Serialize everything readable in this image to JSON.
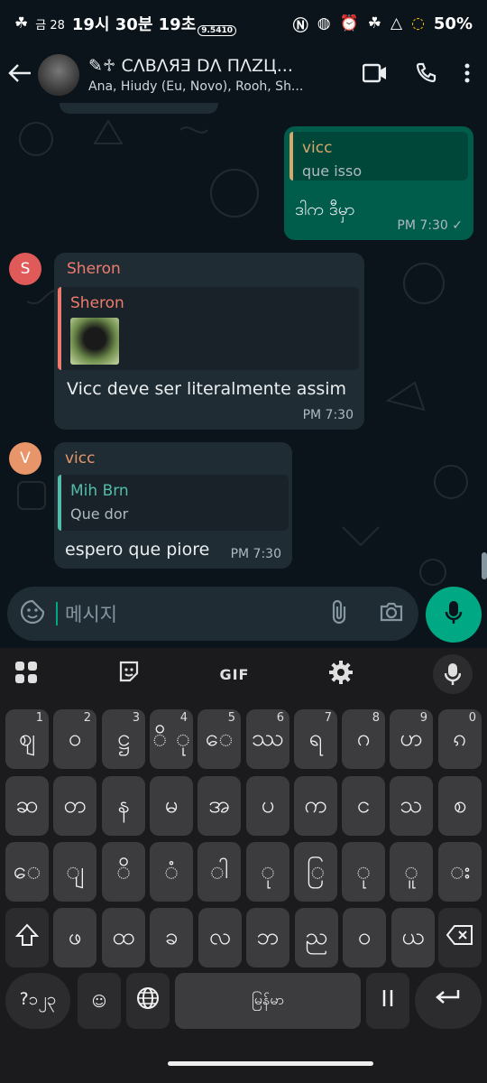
{
  "status": {
    "time": "19시 30분 19초",
    "date_prefix": "금 28",
    "badge": "9.5410",
    "battery": "50%"
  },
  "header": {
    "title": "✎♱ CΛBΛЯƎ DΛ ПΛZЦ...",
    "subtitle": "Ana, Hiudy (Eu, Novo), Rooh, Sh..."
  },
  "messages": {
    "m1": {
      "quote_name": "vicc",
      "quote_text": "que isso",
      "text": "ဒါက ဒီမှာ",
      "time": "PM 7:30",
      "check": "✓"
    },
    "m2": {
      "avatar_letter": "S",
      "sender": "Sheron",
      "quote_name": "Sheron",
      "text": "Vicc deve ser literalmente assim",
      "time": "PM 7:30"
    },
    "m3": {
      "avatar_letter": "V",
      "sender": "vicc",
      "quote_name": "Mih Brn",
      "quote_text": "Que dor",
      "text": "espero que piore",
      "time": "PM 7:30"
    }
  },
  "input": {
    "placeholder": "메시지"
  },
  "keyboard": {
    "gif_label": "GIF",
    "row1": [
      {
        "char": "ဈ",
        "num": "1"
      },
      {
        "char": "ဝ",
        "num": "2"
      },
      {
        "char": "ဋ္ဌ",
        "num": "3"
      },
      {
        "char": "ိ ု",
        "num": "4"
      },
      {
        "char": "ေ",
        "num": "5"
      },
      {
        "char": "ဿ",
        "num": "6"
      },
      {
        "char": "ရ",
        "num": "7"
      },
      {
        "char": "ဂ",
        "num": "8"
      },
      {
        "char": "ဟ",
        "num": "9"
      },
      {
        "char": "ၵ",
        "num": "0"
      }
    ],
    "row2": [
      "ဆ",
      "တ",
      "န",
      "မ",
      "အ",
      "ပ",
      "က",
      "င",
      "သ",
      "စ"
    ],
    "row3": [
      "ေ",
      "ျ",
      "ိ",
      "ံ",
      "ါ",
      "ု",
      "ြ",
      "ု",
      "ူ",
      "း"
    ],
    "row4": [
      "ဖ",
      "ထ",
      "ခ",
      "လ",
      "ဘ",
      "ည",
      "ဝ",
      "ယ"
    ],
    "row5": {
      "sym": "?၁၂၃",
      "emoji": "☺",
      "space": "မြန်မာ"
    }
  }
}
